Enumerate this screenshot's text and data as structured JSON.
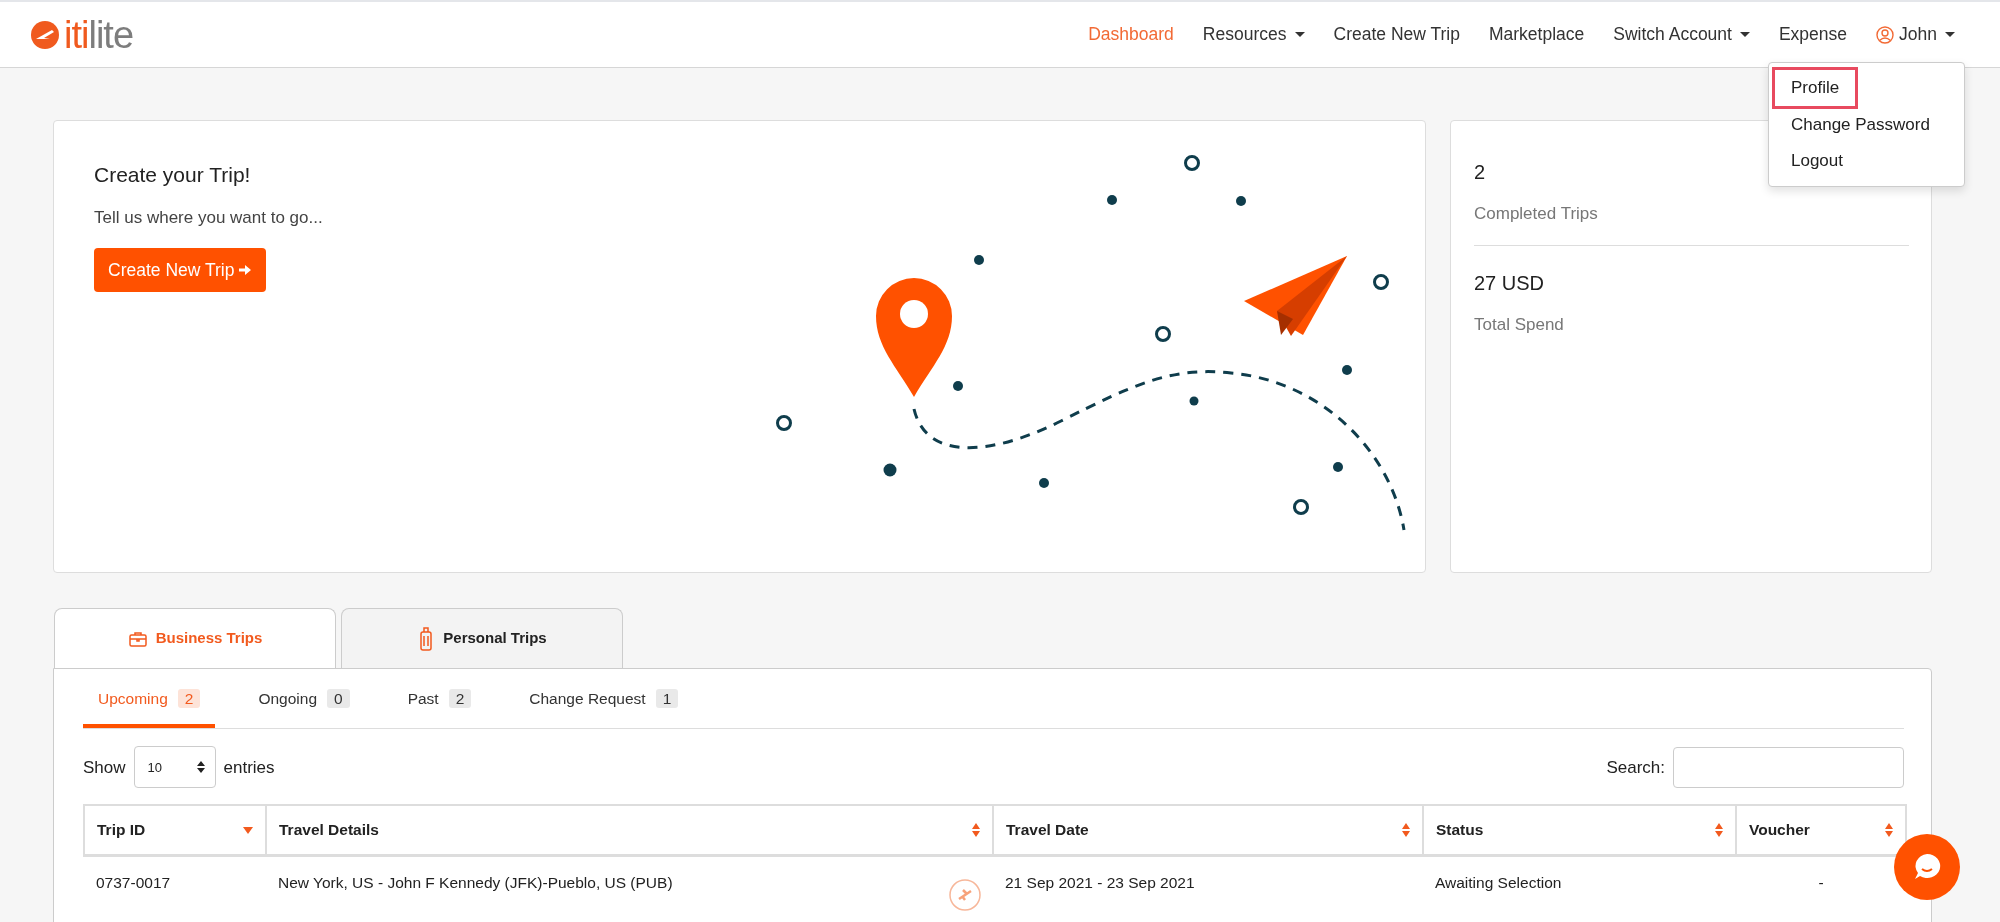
{
  "navbar": {
    "logo": {
      "accent": "iti",
      "rest": "lite"
    },
    "items": [
      {
        "label": "Dashboard",
        "selected": true,
        "dropdown": false,
        "kind": "link"
      },
      {
        "label": "Resources",
        "selected": false,
        "dropdown": true,
        "kind": "link"
      },
      {
        "label": "Create New Trip",
        "selected": false,
        "dropdown": false,
        "kind": "link"
      },
      {
        "label": "Marketplace",
        "selected": false,
        "dropdown": false,
        "kind": "link"
      },
      {
        "label": "Switch Account",
        "selected": false,
        "dropdown": true,
        "kind": "link"
      },
      {
        "label": "Expense",
        "selected": false,
        "dropdown": false,
        "kind": "link"
      },
      {
        "label": "John",
        "selected": false,
        "dropdown": true,
        "kind": "user"
      }
    ]
  },
  "user_menu": {
    "items": [
      {
        "label": "Profile",
        "highlighted": true
      },
      {
        "label": "Change Password",
        "highlighted": false
      },
      {
        "label": "Logout",
        "highlighted": false
      }
    ]
  },
  "create_card": {
    "title": "Create your Trip!",
    "subtitle": "Tell us where you want to go...",
    "button": "Create New Trip"
  },
  "stats": [
    {
      "value": "2",
      "label": "Completed Trips"
    },
    {
      "value": "27 USD",
      "label": "Total Spend"
    }
  ],
  "trip_tabs": [
    {
      "label": "Business Trips",
      "selected": true,
      "kind": "briefcase"
    },
    {
      "label": "Personal Trips",
      "selected": false,
      "kind": "luggage"
    }
  ],
  "sub_tabs": [
    {
      "label": "Upcoming",
      "count": "2",
      "selected": true
    },
    {
      "label": "Ongoing",
      "count": "0",
      "selected": false
    },
    {
      "label": "Past",
      "count": "2",
      "selected": false
    },
    {
      "label": "Change Request",
      "count": "1",
      "selected": false
    }
  ],
  "length": {
    "before": "Show",
    "value": "10",
    "after": "entries"
  },
  "search": {
    "label": "Search:"
  },
  "table": {
    "columns": [
      {
        "label": "Trip ID",
        "sorted": true
      },
      {
        "label": "Travel Details",
        "sorted": false
      },
      {
        "label": "Travel Date",
        "sorted": false
      },
      {
        "label": "Status",
        "sorted": false
      },
      {
        "label": "Voucher",
        "sorted": false
      }
    ],
    "rows": [
      {
        "cells": [
          "0737-0017",
          "New York, US - John F Kennedy (JFK)-Pueblo, US (PUB)",
          "21 Sep 2021 - 23 Sep 2021",
          "Awaiting Selection",
          "-"
        ],
        "kind": "flight"
      }
    ]
  }
}
